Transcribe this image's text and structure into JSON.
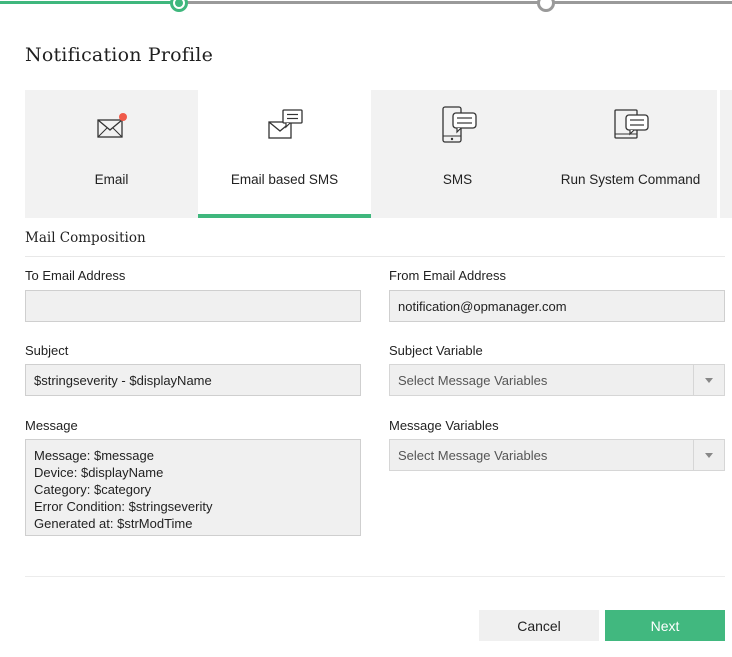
{
  "page": {
    "title": "Notification Profile"
  },
  "stepper": {
    "current_step": 2,
    "total_steps": 3
  },
  "tabs": [
    {
      "label": "Email",
      "icon": "envelope-icon",
      "active": false
    },
    {
      "label": "Email based SMS",
      "icon": "envelope-message-icon",
      "active": true
    },
    {
      "label": "SMS",
      "icon": "mobile-message-icon",
      "active": false
    },
    {
      "label": "Run System Command",
      "icon": "device-command-icon",
      "active": false
    }
  ],
  "section": {
    "title": "Mail Composition"
  },
  "form": {
    "to_email": {
      "label": "To Email Address",
      "value": ""
    },
    "from_email": {
      "label": "From Email Address",
      "value": "notification@opmanager.com"
    },
    "subject": {
      "label": "Subject",
      "value": "$stringseverity - $displayName"
    },
    "subject_variable": {
      "label": "Subject Variable",
      "placeholder": "Select Message Variables"
    },
    "message": {
      "label": "Message",
      "value": "Message: $message\nDevice: $displayName\nCategory: $category\nError Condition: $stringseverity\nGenerated at: $strModTime"
    },
    "message_variables": {
      "label": "Message Variables",
      "placeholder": "Select Message Variables"
    }
  },
  "buttons": {
    "cancel": "Cancel",
    "next": "Next"
  },
  "colors": {
    "accent": "#41b87f",
    "field_bg": "#f0f0f0",
    "tab_bg": "#f2f2f2",
    "alert_dot": "#f05a4a"
  }
}
